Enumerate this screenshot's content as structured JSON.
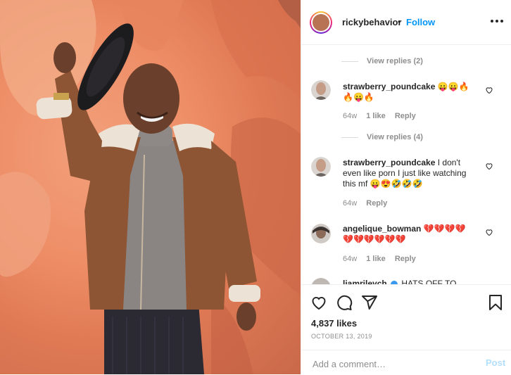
{
  "header": {
    "username": "rickybehavior",
    "separator": "•",
    "follow_label": "Follow",
    "more_icon": "more-options-icon"
  },
  "comments": [
    {
      "type": "view_replies",
      "label": "View replies (2)"
    },
    {
      "type": "comment",
      "username": "strawberry_poundcake",
      "text_line1": "😛😛🔥",
      "text_line2": "🔥😛🔥",
      "age": "64w",
      "likes": "1 like",
      "reply": "Reply"
    },
    {
      "type": "view_replies",
      "label": "View replies (4)"
    },
    {
      "type": "comment",
      "username": "strawberry_poundcake",
      "text": "I don't even like porn I just like watching this mf 😛😍🤣🤣🤣",
      "age": "64w",
      "reply": "Reply"
    },
    {
      "type": "comment",
      "username": "angelique_bowman",
      "text_line1": "💔💔💔💔",
      "text_line2": "💔💔💔💔💔💔",
      "age": "64w",
      "likes": "1 like",
      "reply": "Reply"
    },
    {
      "type": "comment",
      "username": "liamrileych",
      "text": "HATS OFF TO"
    }
  ],
  "actions": {
    "like_icon": "heart-icon",
    "comment_icon": "comment-icon",
    "share_icon": "share-icon",
    "save_icon": "bookmark-icon",
    "likes": "4,837 likes",
    "date": "OCTOBER 13, 2019"
  },
  "add_comment": {
    "placeholder": "Add a comment…",
    "post_label": "Post"
  },
  "colors": {
    "link_blue": "#0095f6",
    "post_disabled": "#b2dffc",
    "muted": "#8e8e8e",
    "background_wall": "#ee8e67"
  }
}
